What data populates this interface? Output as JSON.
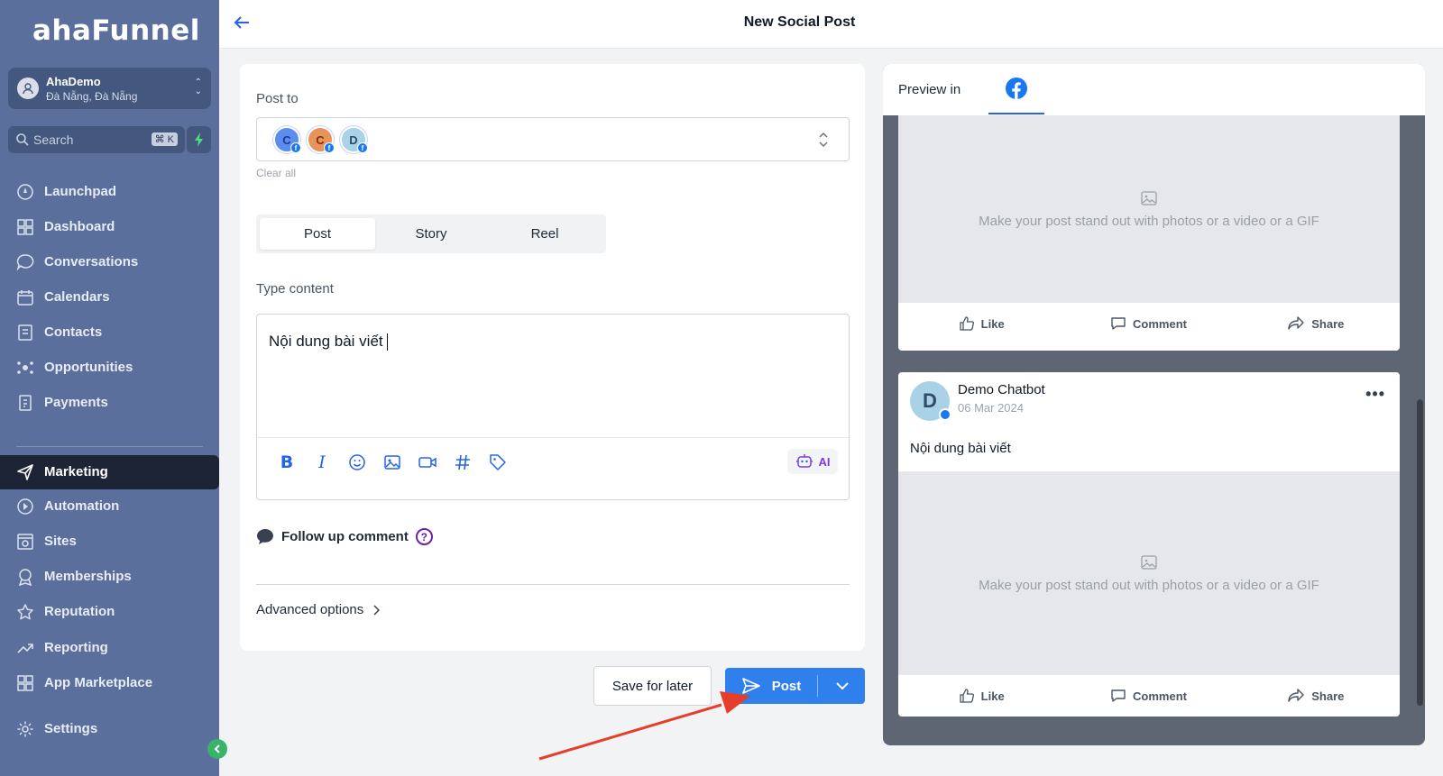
{
  "app": {
    "logo": "ahaFunnel",
    "account_name": "AhaDemo",
    "account_location": "Đà Nẵng, Đà Nẵng",
    "search_placeholder": "Search",
    "search_shortcut": "⌘ K"
  },
  "sidebar": {
    "items": [
      {
        "label": "Launchpad",
        "icon": "rocket-icon"
      },
      {
        "label": "Dashboard",
        "icon": "grid-icon"
      },
      {
        "label": "Conversations",
        "icon": "chat-icon"
      },
      {
        "label": "Calendars",
        "icon": "calendar-icon"
      },
      {
        "label": "Contacts",
        "icon": "contacts-icon"
      },
      {
        "label": "Opportunities",
        "icon": "opportunities-icon"
      },
      {
        "label": "Payments",
        "icon": "payments-icon"
      },
      {
        "label": "Marketing",
        "icon": "send-icon",
        "active": true
      },
      {
        "label": "Automation",
        "icon": "automation-icon"
      },
      {
        "label": "Sites",
        "icon": "sites-icon"
      },
      {
        "label": "Memberships",
        "icon": "memberships-icon"
      },
      {
        "label": "Reputation",
        "icon": "star-icon"
      },
      {
        "label": "Reporting",
        "icon": "trend-icon"
      },
      {
        "label": "App Marketplace",
        "icon": "grid-icon"
      },
      {
        "label": "Settings",
        "icon": "gear-icon"
      }
    ]
  },
  "header": {
    "title": "New Social Post"
  },
  "editor": {
    "post_to_label": "Post to",
    "accounts": [
      {
        "initial": "C",
        "color": "#5b8def"
      },
      {
        "initial": "C",
        "color": "#e8935a"
      },
      {
        "initial": "D",
        "color": "#a9d2e6"
      }
    ],
    "clear_all": "Clear all",
    "tabs": [
      "Post",
      "Story",
      "Reel"
    ],
    "active_tab": "Post",
    "content_label": "Type content",
    "content": "Nội dung bài viết",
    "ai_label": "AI",
    "follow_up": "Follow up comment",
    "help_mark": "?",
    "advanced": "Advanced options"
  },
  "actions": {
    "save_for_later": "Save for later",
    "post": "Post"
  },
  "preview": {
    "label": "Preview in",
    "media_placeholder": "Make your post stand out with photos or a video or a GIF",
    "like": "Like",
    "comment": "Comment",
    "share": "Share",
    "page_name": "Demo Chatbot",
    "page_initial": "D",
    "date": "06 Mar 2024",
    "post_text": "Nội dung bài viết"
  },
  "colors": {
    "sidebar": "#5a6f9c",
    "primary": "#2f80ed",
    "facebook": "#1877f2",
    "arrow": "#e53e2b"
  }
}
